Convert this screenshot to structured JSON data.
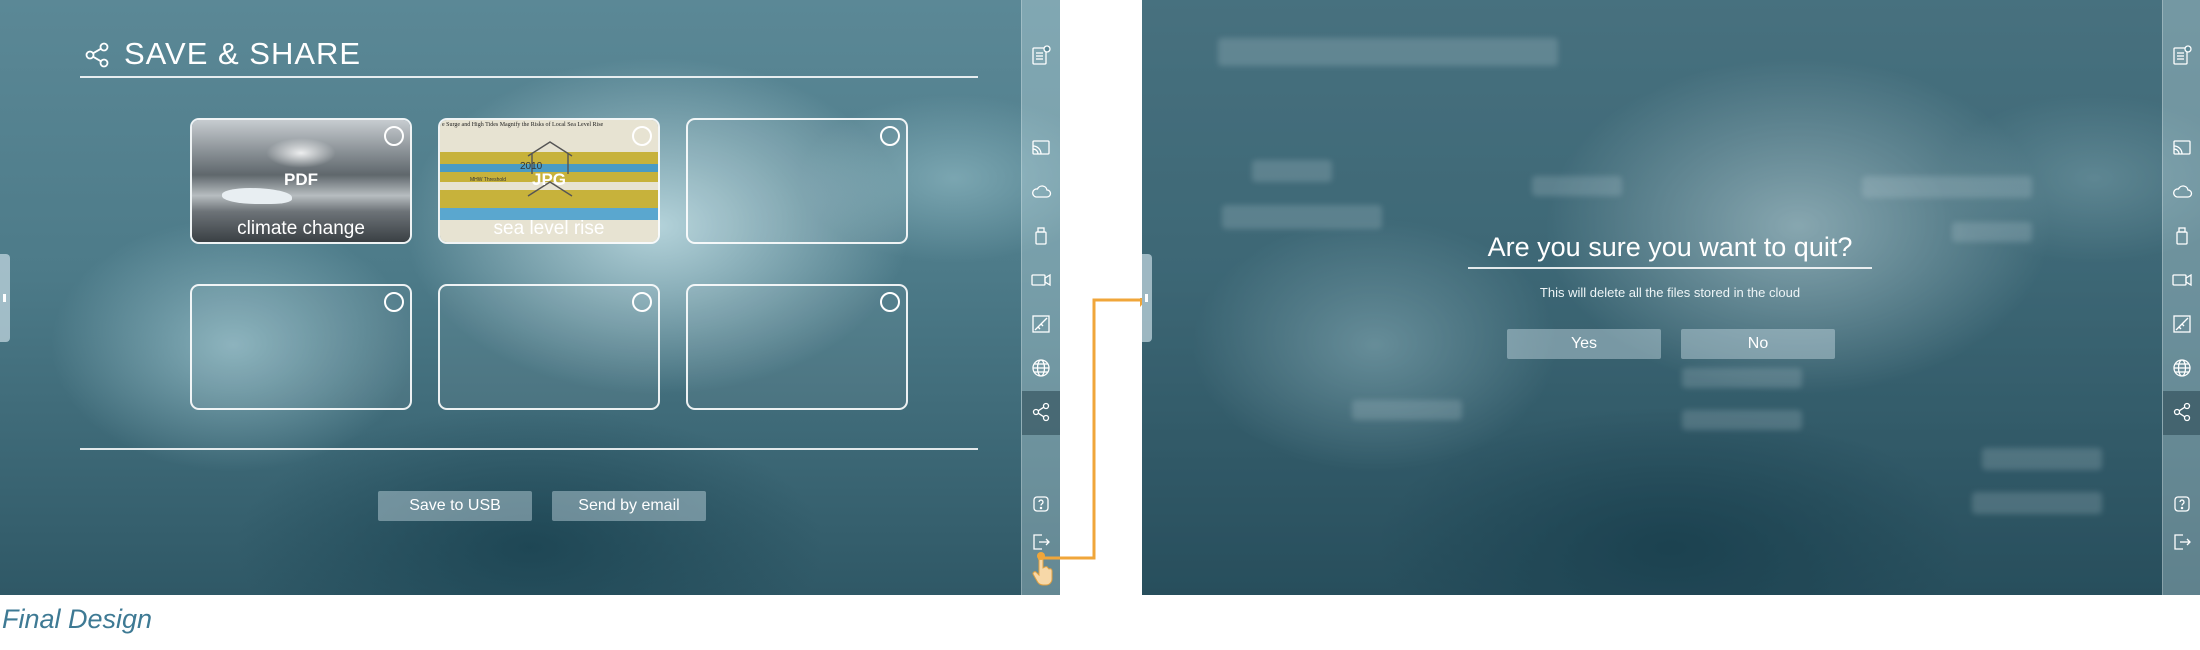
{
  "left_screen": {
    "title": "SAVE & SHARE",
    "cards": [
      {
        "type_label": "PDF",
        "caption": "climate change"
      },
      {
        "type_label": "JPG",
        "caption": "sea level rise",
        "thumb_heading": "e Surge and High Tides Magnify the Risks of Local Sea Level Rise",
        "thumb_year": "2010",
        "thumb_sub": "MHW Threshold"
      },
      {
        "type_label": "",
        "caption": ""
      },
      {
        "type_label": "",
        "caption": ""
      },
      {
        "type_label": "",
        "caption": ""
      },
      {
        "type_label": "",
        "caption": ""
      }
    ],
    "save_usb_label": "Save to USB",
    "send_email_label": "Send by email"
  },
  "right_screen": {
    "dialog_title": "Are you sure you want to quit?",
    "dialog_message": "This will delete all the files stored in the cloud",
    "yes_label": "Yes",
    "no_label": "No"
  },
  "sidebar_icons": [
    "document-icon",
    "cast-icon",
    "cloud-icon",
    "usb-icon",
    "video-icon",
    "ruler-icon",
    "globe-icon",
    "share-icon",
    "help-icon",
    "exit-icon"
  ],
  "active_sidebar_item": "share-icon",
  "caption": "Final Design",
  "colors": {
    "accent": "#f0a63a",
    "caption": "#3e7a94",
    "background": "#4d7b89"
  }
}
